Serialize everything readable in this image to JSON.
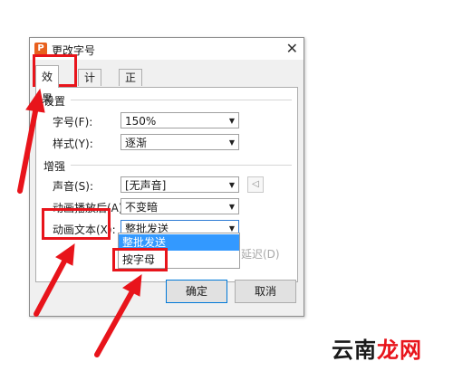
{
  "dialog": {
    "title": "更改字号",
    "app_icon_glyph": "P",
    "close_glyph": "✕",
    "tabs": [
      {
        "label": "效果"
      },
      {
        "label": "计时"
      },
      {
        "label": "正文文本动画"
      }
    ],
    "settings": {
      "section_title": "设置",
      "fields": [
        {
          "label": "字号(F):",
          "value": "150%"
        },
        {
          "label": "样式(Y):",
          "value": "逐渐"
        }
      ]
    },
    "enhance": {
      "section_title": "增强",
      "fields": [
        {
          "label": "声音(S):",
          "value": "[无声音]"
        },
        {
          "label": "动画播放后(A):",
          "value": "不变暗"
        },
        {
          "label": "动画文本(X):",
          "value": "整批发送"
        }
      ],
      "dropdown_options": [
        "整批发送",
        "按字母"
      ],
      "partial_delay_text": "延迟(D)"
    },
    "buttons": {
      "ok": "确定",
      "cancel": "取消"
    }
  },
  "watermark": {
    "text_black": "云南",
    "text_red": "龙网"
  },
  "colors": {
    "annotation_red": "#e8141b",
    "selection_blue": "#3399ff",
    "app_icon_orange": "#e8601e"
  }
}
